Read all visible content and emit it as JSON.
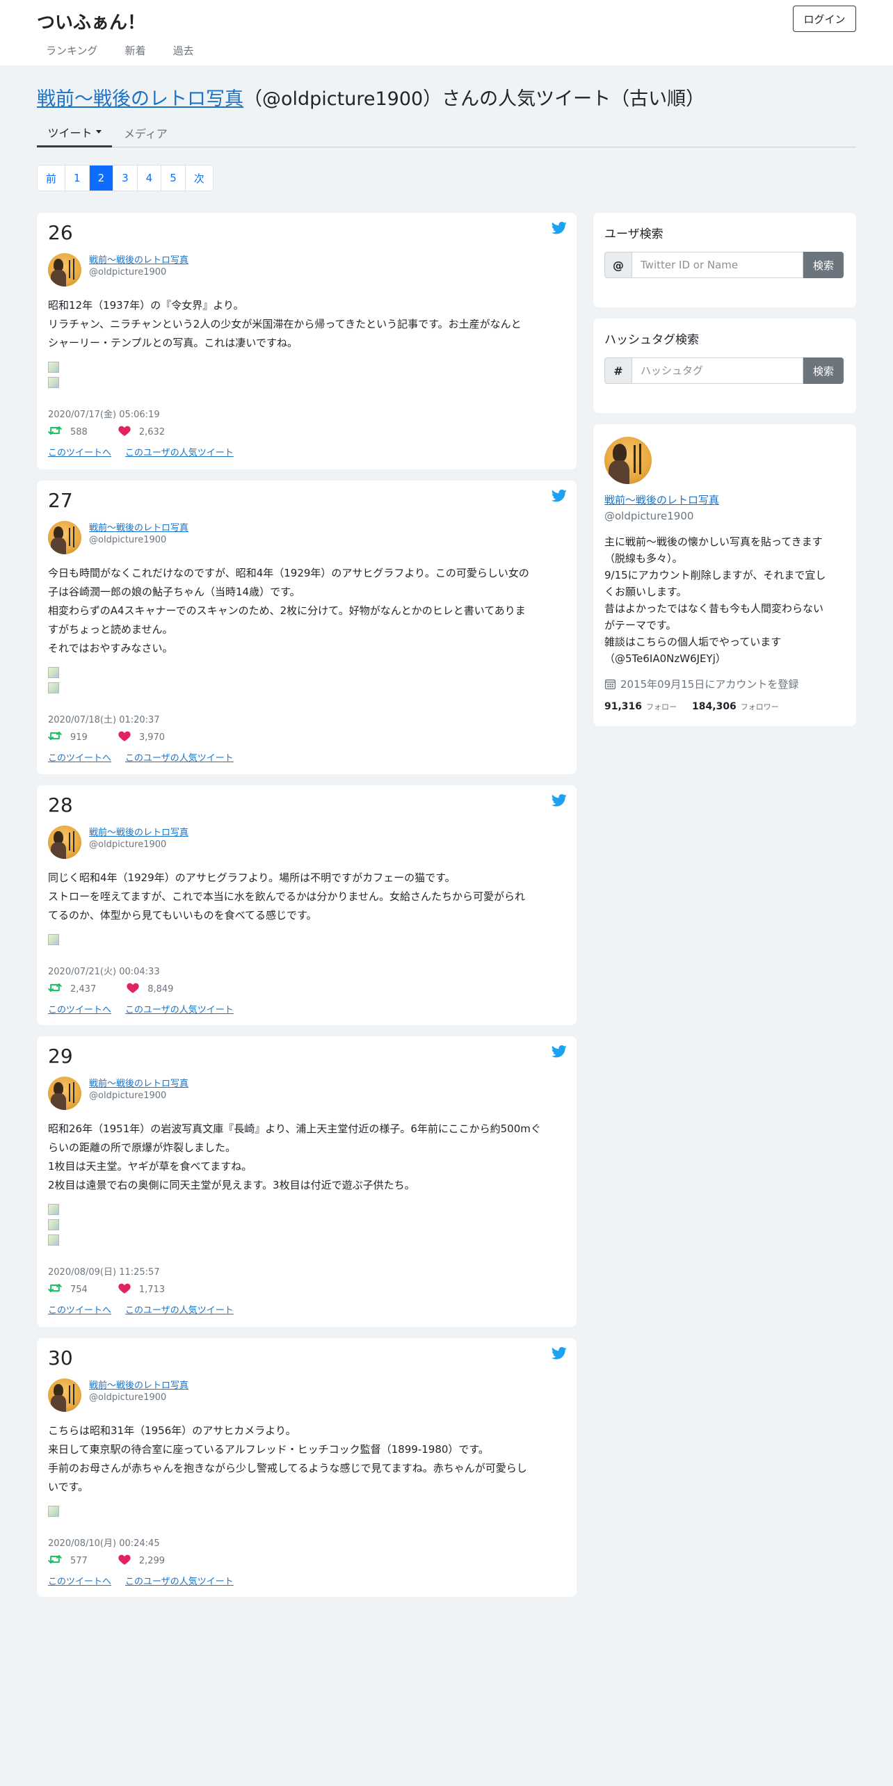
{
  "site": {
    "brand": "ついふぁん！",
    "login_label": "ログイン"
  },
  "nav": [
    "ランキング",
    "新着",
    "過去"
  ],
  "title": {
    "name_link": "戦前～戦後のレトロ写真",
    "suffix": "（@oldpicture1900）さんの人気ツイート（古い順）"
  },
  "tabs": {
    "tweets": "ツイート",
    "media": "メディア"
  },
  "pagination": {
    "prev": "前",
    "pages": [
      "1",
      "2",
      "3",
      "4",
      "5"
    ],
    "active": "2",
    "next": "次"
  },
  "tweets": [
    {
      "rank": "26",
      "user_name": "戦前～戦後のレトロ写真",
      "handle": "@oldpicture1900",
      "lines": [
        "昭和12年（1937年）の『令女界』より。",
        "リラチャン、ニラチャンという2人の少女が米国滞在から帰ってきたという記事です。お土産がなんと",
        "シャーリー・テンプルとの写真。これは凄いですね。"
      ],
      "images": 2,
      "date": "2020/07/17(金) 05:06:19",
      "retweets": "588",
      "likes": "2,632",
      "link_tweet": "このツイートへ",
      "link_user": "このユーザの人気ツイート"
    },
    {
      "rank": "27",
      "user_name": "戦前～戦後のレトロ写真",
      "handle": "@oldpicture1900",
      "lines": [
        "今日も時間がなくこれだけなのですが、昭和4年（1929年）のアサヒグラフより。この可愛らしい女の",
        "子は谷崎潤一郎の娘の鮎子ちゃん（当時14歳）です。",
        "相変わらずのA4スキャナーでのスキャンのため、2枚に分けて。好物がなんとかのヒレと書いてありま",
        "すがちょっと読めません。",
        "それではおやすみなさい。"
      ],
      "images": 2,
      "date": "2020/07/18(土) 01:20:37",
      "retweets": "919",
      "likes": "3,970",
      "link_tweet": "このツイートへ",
      "link_user": "このユーザの人気ツイート"
    },
    {
      "rank": "28",
      "user_name": "戦前～戦後のレトロ写真",
      "handle": "@oldpicture1900",
      "lines": [
        "同じく昭和4年（1929年）のアサヒグラフより。場所は不明ですがカフェーの猫です。",
        "ストローを咥えてますが、これで本当に水を飲んでるかは分かりません。女給さんたちから可愛がられ",
        "てるのか、体型から見てもいいものを食べてる感じです。"
      ],
      "images": 1,
      "date": "2020/07/21(火) 00:04:33",
      "retweets": "2,437",
      "likes": "8,849",
      "link_tweet": "このツイートへ",
      "link_user": "このユーザの人気ツイート"
    },
    {
      "rank": "29",
      "user_name": "戦前～戦後のレトロ写真",
      "handle": "@oldpicture1900",
      "lines": [
        "昭和26年（1951年）の岩波写真文庫『長崎』より、浦上天主堂付近の様子。6年前にここから約500mぐ",
        "らいの距離の所で原爆が炸裂しました。",
        "1枚目は天主堂。ヤギが草を食べてますね。",
        "2枚目は遠景で右の奥側に同天主堂が見えます。3枚目は付近で遊ぶ子供たち。"
      ],
      "images": 3,
      "date": "2020/08/09(日) 11:25:57",
      "retweets": "754",
      "likes": "1,713",
      "link_tweet": "このツイートへ",
      "link_user": "このユーザの人気ツイート"
    },
    {
      "rank": "30",
      "user_name": "戦前～戦後のレトロ写真",
      "handle": "@oldpicture1900",
      "lines": [
        "こちらは昭和31年（1956年）のアサヒカメラより。",
        "来日して東京駅の待合室に座っているアルフレッド・ヒッチコック監督（1899-1980）です。",
        "手前のお母さんが赤ちゃんを抱きながら少し警戒してるような感じで見てますね。赤ちゃんが可愛らし",
        "いです。"
      ],
      "images": 1,
      "date": "2020/08/10(月) 00:24:45",
      "retweets": "577",
      "likes": "2,299",
      "link_tweet": "このツイートへ",
      "link_user": "このユーザの人気ツイート"
    }
  ],
  "sidebar": {
    "user_search": {
      "title": "ユーザ検索",
      "prefix": "@",
      "placeholder": "Twitter ID or Name",
      "button": "検索"
    },
    "hashtag_search": {
      "title": "ハッシュタグ検索",
      "prefix": "#",
      "placeholder": "ハッシュタグ",
      "button": "検索"
    },
    "profile": {
      "name": "戦前～戦後のレトロ写真",
      "handle": "@oldpicture1900",
      "bio": [
        "主に戦前～戦後の懐かしい写真を貼ってきます",
        "（脱線も多々）。",
        "9/15にアカウント削除しますが、それまで宜し",
        "くお願いします。",
        "昔はよかったではなく昔も今も人間変わらない",
        "がテーマです。",
        "雑談はこちらの個人垢でやっています",
        "（@5Te6IA0NzW6JEYj）"
      ],
      "joined": "2015年09月15日にアカウントを登録",
      "following": "91,316",
      "following_label": "フォロー",
      "followers": "184,306",
      "followers_label": "フォロワー"
    }
  },
  "colors": {
    "retweet": "#17bf63",
    "like": "#e0245e",
    "twitter": "#1da1f2",
    "link": "#1a73c9",
    "active_page": "#0d6efd"
  }
}
